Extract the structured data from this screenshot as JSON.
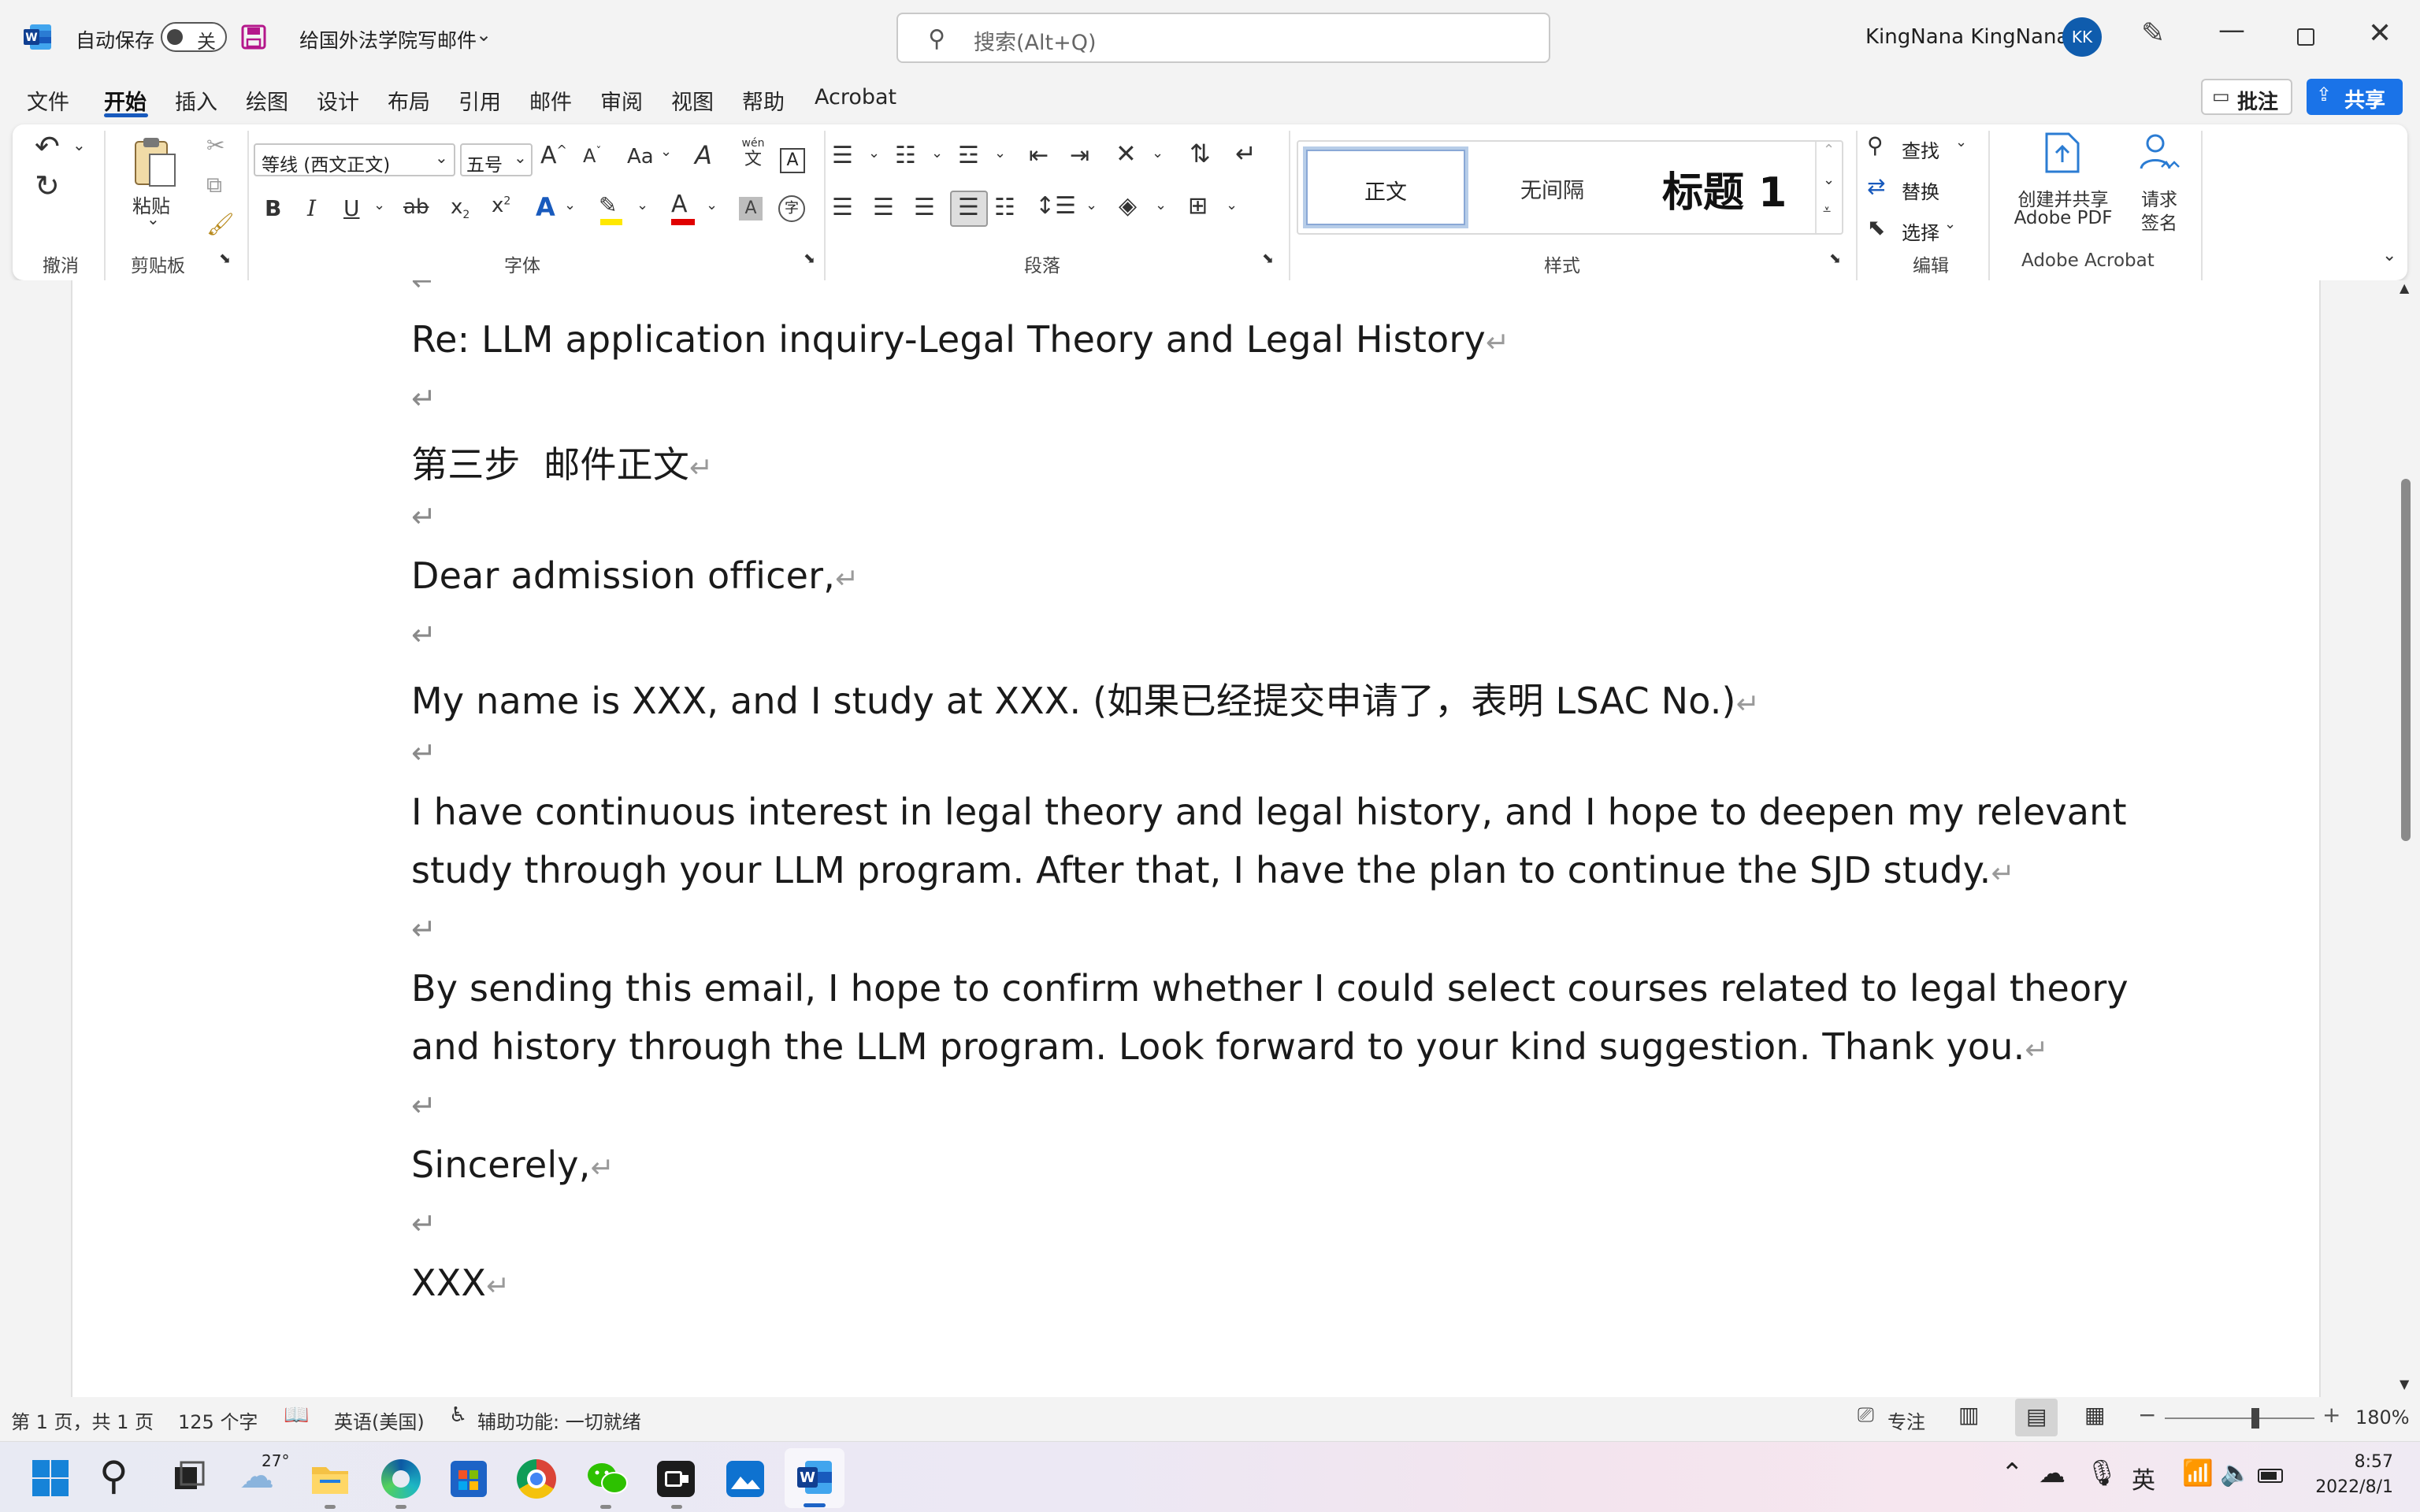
{
  "titlebar": {
    "autosave_label": "自动保存",
    "autosave_state": "关",
    "document_title": "给国外法学院写邮件",
    "search_placeholder": "搜索(Alt+Q)",
    "user_name": "KingNana KingNana",
    "user_initials": "KK"
  },
  "tabs": [
    "文件",
    "开始",
    "插入",
    "绘图",
    "设计",
    "布局",
    "引用",
    "邮件",
    "审阅",
    "视图",
    "帮助",
    "Acrobat"
  ],
  "active_tab": "开始",
  "comment_button": "批注",
  "share_button": "共享",
  "ribbon": {
    "undo_group": "撤消",
    "paste_label": "粘贴",
    "clipboard_group": "剪贴板",
    "font_name": "等线 (西文正文)",
    "font_size": "五号",
    "font_group": "字体",
    "paragraph_group": "段落",
    "styles": [
      "正文",
      "无间隔",
      "标题 1"
    ],
    "styles_group": "样式",
    "find": "查找",
    "replace": "替换",
    "select": "选择",
    "edit_group": "编辑",
    "create_share_pdf": [
      "创建并共享",
      "Adobe PDF"
    ],
    "request_sign": [
      "请求",
      "签名"
    ],
    "acrobat_group": "Adobe Acrobat",
    "aa_label": "Aa",
    "wen_label": "wén",
    "wen_char": "文"
  },
  "document": {
    "lines": [
      "Re: LLM application inquiry-Legal Theory and Legal History",
      "第三步  邮件正文",
      "Dear admission officer,",
      "My name is XXX, and I study at XXX. (如果已经提交申请了，表明 LSAC No.)",
      "I have continuous interest in legal theory and legal history, and I hope to deepen my relevant",
      "study through your LLM program. After that, I have the plan to continue the SJD study.",
      "By sending this email, I hope to confirm whether I could select courses related to legal theory",
      "and history through the LLM program. Look forward to your kind suggestion. Thank you.",
      "Sincerely,",
      "XXX"
    ],
    "paragraph_mark": "↵"
  },
  "statusbar": {
    "page": "第 1 页，共 1 页",
    "words": "125 个字",
    "language": "英语(美国)",
    "accessibility": "辅助功能: 一切就绪",
    "focus": "专注",
    "zoom": "180%"
  },
  "taskbar": {
    "weather_temp": "27°",
    "ime": "英",
    "time": "8:57",
    "date": "2022/8/1"
  },
  "colors": {
    "word_blue": "#185abd",
    "share_blue": "#1a73e8",
    "avatar": "#0f5cad"
  }
}
